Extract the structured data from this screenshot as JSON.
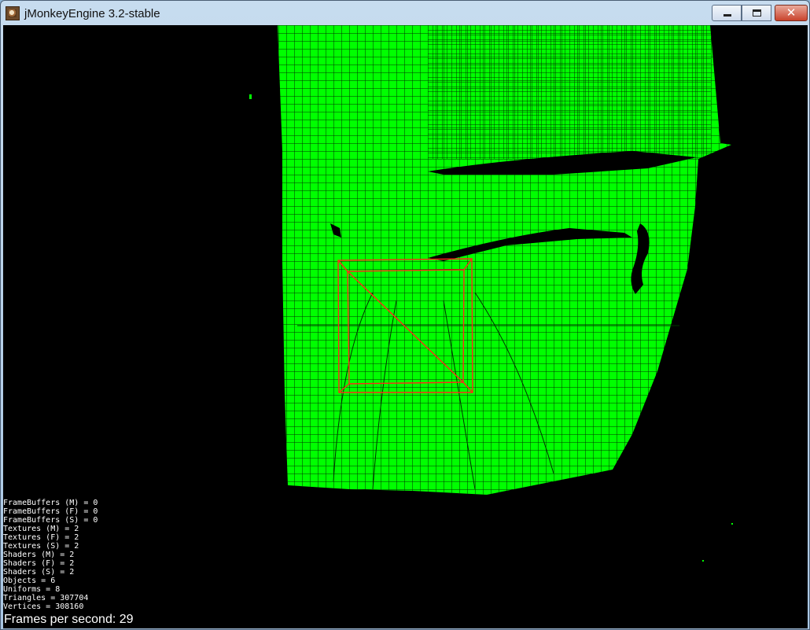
{
  "window": {
    "title": "jMonkeyEngine 3.2-stable",
    "app_icon": "jmonkey-logo-icon",
    "controls": {
      "minimize": "minimize-icon",
      "maximize": "maximize-icon",
      "close": "close-icon",
      "close_glyph": "✕"
    }
  },
  "scene": {
    "background": "#000000",
    "mesh_color": "#00ff00",
    "wire_color": "#003300",
    "box_color": "#ff2a1a"
  },
  "stats": [
    "FrameBuffers (M) = 0",
    "FrameBuffers (F) = 0",
    "FrameBuffers (S) = 0",
    "Textures (M) = 2",
    "Textures (F) = 2",
    "Textures (S) = 2",
    "Shaders (M) = 2",
    "Shaders (F) = 2",
    "Shaders (S) = 2",
    "Objects = 6",
    "Uniforms = 8",
    "Triangles = 307704",
    "Vertices = 308160"
  ],
  "fps": "Frames per second: 29"
}
